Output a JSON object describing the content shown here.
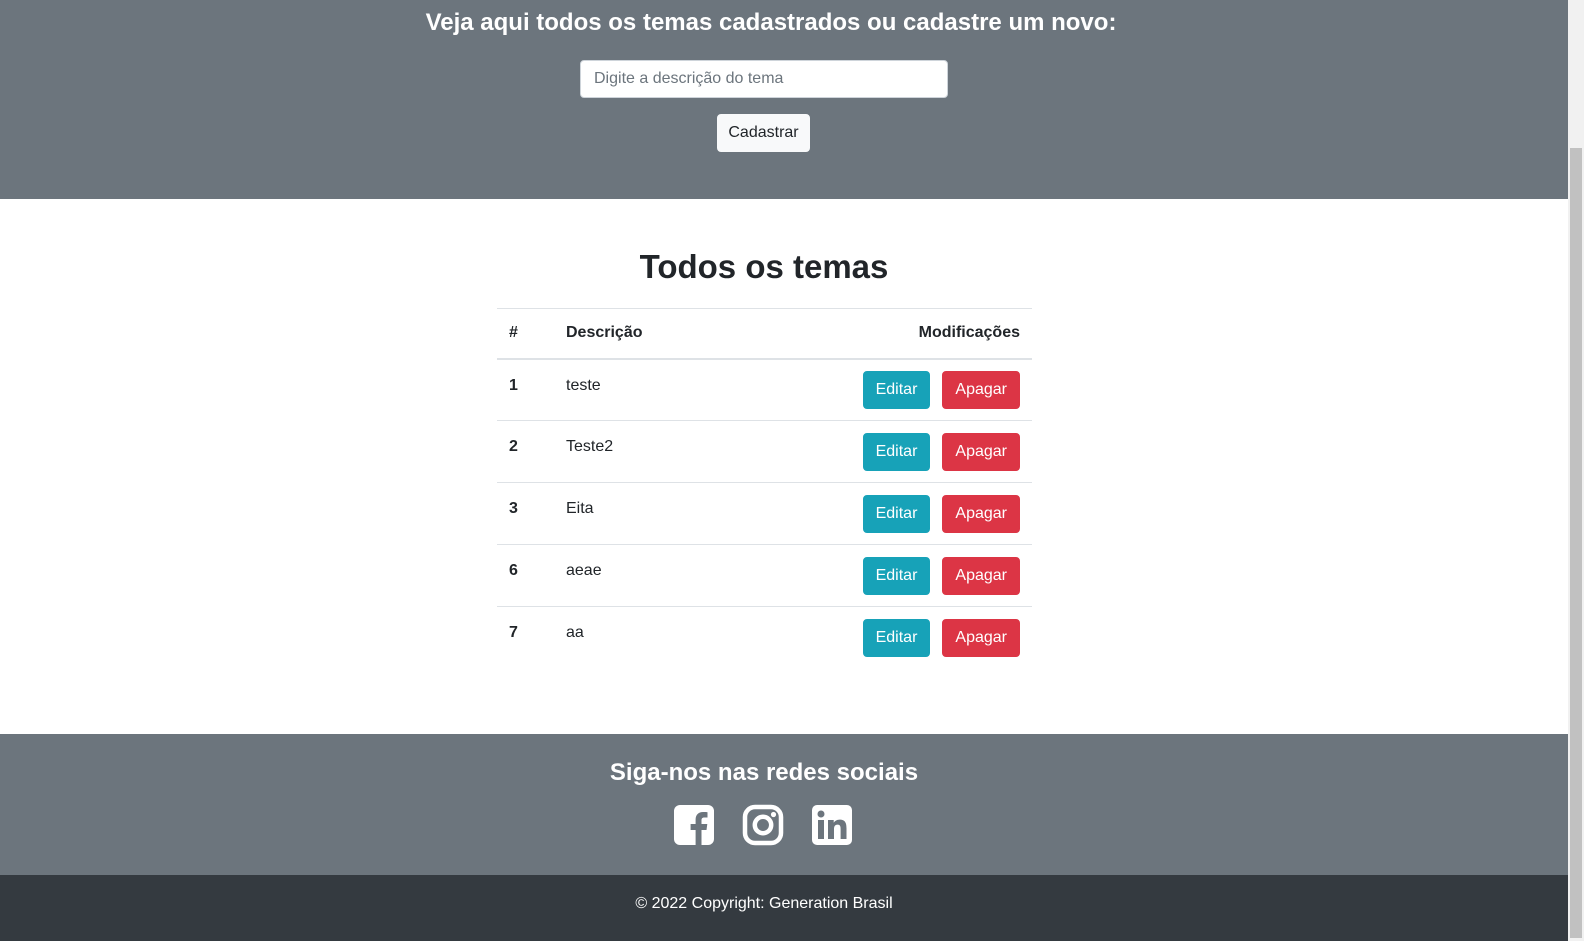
{
  "header": {
    "title": "Veja aqui todos os temas cadastrados ou cadastre um novo:",
    "input_placeholder": "Digite a descrição do tema",
    "input_value": "",
    "submit_label": "Cadastrar"
  },
  "table": {
    "title": "Todos os temas",
    "columns": [
      "#",
      "Descrição",
      "Modificações"
    ],
    "rows": [
      {
        "id": "1",
        "description": "teste",
        "edit_label": "Editar",
        "delete_label": "Apagar"
      },
      {
        "id": "2",
        "description": "Teste2",
        "edit_label": "Editar",
        "delete_label": "Apagar"
      },
      {
        "id": "3",
        "description": "Eita",
        "edit_label": "Editar",
        "delete_label": "Apagar"
      },
      {
        "id": "6",
        "description": "aeae",
        "edit_label": "Editar",
        "delete_label": "Apagar"
      },
      {
        "id": "7",
        "description": "aa",
        "edit_label": "Editar",
        "delete_label": "Apagar"
      }
    ]
  },
  "footer": {
    "social_title": "Siga-nos nas redes sociais",
    "social_icons": [
      "facebook-icon",
      "instagram-icon",
      "linkedin-icon"
    ],
    "copyright": "© 2022 Copyright: Generation Brasil"
  },
  "colors": {
    "header_bg": "#6c757d",
    "footer_dark_bg": "#343a40",
    "edit_button": "#17a2b8",
    "delete_button": "#dc3545"
  }
}
